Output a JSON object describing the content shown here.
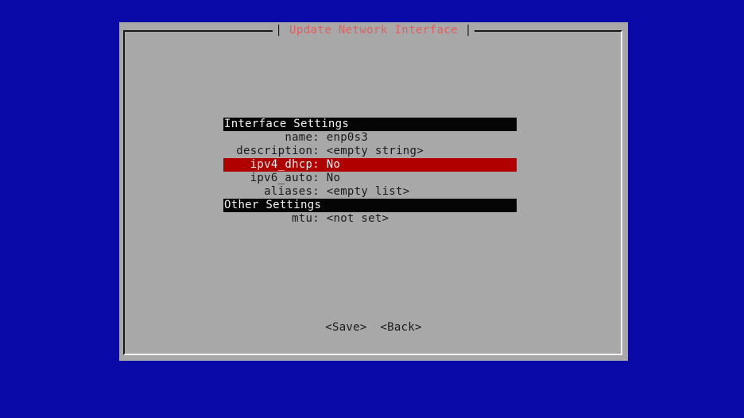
{
  "dialog": {
    "title": "Update Network Interface",
    "title_left": "| ",
    "title_right": " |"
  },
  "sections": {
    "interface_header": "Interface Settings",
    "other_header": "Other Settings"
  },
  "fields": {
    "name": {
      "label": "name:",
      "value": "enp0s3"
    },
    "description": {
      "label": "description:",
      "value": "<empty string>"
    },
    "ipv4_dhcp": {
      "label": "ipv4_dhcp:",
      "value": "No"
    },
    "ipv6_auto": {
      "label": "ipv6_auto:",
      "value": "No"
    },
    "aliases": {
      "label": "aliases:",
      "value": "<empty list>"
    },
    "mtu": {
      "label": "mtu:",
      "value": "<not set>"
    }
  },
  "buttons": {
    "save": "<Save>",
    "back": "<Back>"
  },
  "colors": {
    "background": "#0a0aa8",
    "dialog": "#a8a8a8",
    "title": "#e06060",
    "selected_row": "#b00000",
    "header_row": "#050505"
  }
}
